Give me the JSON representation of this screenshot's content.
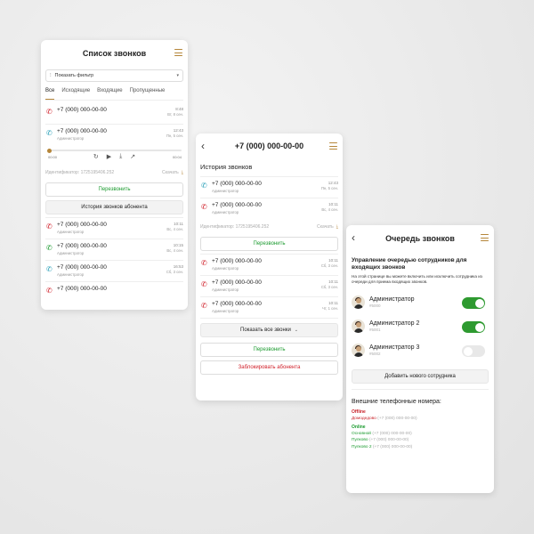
{
  "colors": {
    "accent": "#b5863a",
    "incoming": "#2aa0b8",
    "missed": "#d0202a",
    "outgoing": "#1a9a2e"
  },
  "screen1": {
    "title": "Список звонков",
    "filter_label": "Показать фильтр",
    "tabs": [
      "Все",
      "Исходящие",
      "Входящие",
      "Пропущенные"
    ],
    "calls": [
      {
        "number": "+7 (000) 000-00-00",
        "sub": "Администратор",
        "time": "8:48",
        "date": "Вт, 8 сен.",
        "type": "missed"
      },
      {
        "number": "+7 (000) 000-00-00",
        "sub": "Администратор",
        "time": "12:43",
        "date": "Пн, 5 сен.",
        "type": "incoming"
      },
      {
        "number": "+7 (000) 000-00-00",
        "sub": "Администратор",
        "time": "10:11",
        "date": "Вс, 4 сен.",
        "type": "missed"
      },
      {
        "number": "+7 (000) 000-00-00",
        "sub": "Администратор",
        "time": "10:15",
        "date": "Вс, 4 сен.",
        "type": "outgoing"
      },
      {
        "number": "+7 (000) 000-00-00",
        "sub": "Администратор",
        "time": "16:53",
        "date": "Сб, 3 сен.",
        "type": "incoming"
      },
      {
        "number": "+7 (000) 000-00-00",
        "sub": "",
        "time": "",
        "date": "",
        "type": "missed"
      }
    ],
    "player": {
      "start": "00:00",
      "end": "00:04"
    },
    "identifier": "Идентификатор: 1725195406.252",
    "download": "Скачать",
    "callback": "Перезвонить",
    "history_button": "История звонков абонента"
  },
  "screen2": {
    "title": "+7 (000) 000-00-00",
    "section": "История звонков",
    "calls": [
      {
        "number": "+7 (000) 000-00-00",
        "sub": "Администратор",
        "time": "12:43",
        "date": "Пн, 5 сен.",
        "type": "incoming"
      },
      {
        "number": "+7 (000) 000-00-00",
        "sub": "Администратор",
        "time": "10:11",
        "date": "Вс, 4 сен.",
        "type": "missed"
      },
      {
        "number": "+7 (000) 000-00-00",
        "sub": "Администратор",
        "time": "10:11",
        "date": "Сб, 3 сен.",
        "type": "missed"
      },
      {
        "number": "+7 (000) 000-00-00",
        "sub": "Администратор",
        "time": "10:11",
        "date": "Сб, 3 сен.",
        "type": "missed"
      },
      {
        "number": "+7 (000) 000-00-00",
        "sub": "Администратор",
        "time": "10:11",
        "date": "Чт, 1 сен.",
        "type": "missed"
      }
    ],
    "identifier": "Идентификатор: 1725195406.252",
    "download": "Скачать",
    "callback": "Перезвонить",
    "show_all": "Показать все звонки",
    "callback2": "Перезвонить",
    "block": "Заблокировать абонента"
  },
  "screen3": {
    "title": "Очередь звонков",
    "heading": "Управление очередью сотрудников для входящих звонков",
    "description": "На этой странице вы можете включить или исключить сотрудника из очереди для приема входящих звонков.",
    "employees": [
      {
        "name": "Администратор",
        "id": "#5000",
        "enabled": true
      },
      {
        "name": "Администратор 2",
        "id": "#5001",
        "enabled": true
      },
      {
        "name": "Администратор 3",
        "id": "#5002",
        "enabled": false
      }
    ],
    "add_button": "Добавить нового сотрудника",
    "external_title": "Внешние телефонные номера:",
    "offline_label": "Offline",
    "offline": [
      {
        "name": "Домодедово",
        "number": "(+7 (000) 000-00-00)"
      }
    ],
    "online_label": "Online",
    "online": [
      {
        "name": "Основной",
        "number": "(+7 (000) 000-00-00)"
      },
      {
        "name": "Пулково",
        "number": "(+7 (000) 000-00-00)"
      },
      {
        "name": "Пулково 2",
        "number": "(+7 (000) 000-00-00)"
      }
    ]
  }
}
